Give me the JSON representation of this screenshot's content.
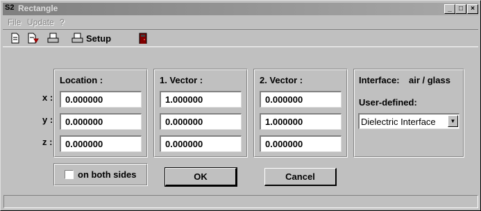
{
  "window": {
    "title": "Rectangle",
    "icon_text": "S2"
  },
  "titlebar_buttons": {
    "minimize": "_",
    "maximize": "□",
    "close": "×"
  },
  "menu": [
    {
      "label": "File"
    },
    {
      "label": "Update"
    },
    {
      "label": "?"
    }
  ],
  "toolbar": {
    "setup_label": "Setup",
    "icons": [
      "new-document-icon",
      "save-document-icon",
      "print-icon",
      "printer-icon",
      "exit-door-icon"
    ]
  },
  "axes": {
    "x": "x :",
    "y": "y :",
    "z": "z :"
  },
  "location": {
    "title": "Location :",
    "x": "0.000000",
    "y": "0.000000",
    "z": "0.000000"
  },
  "vector1": {
    "title": "1. Vector :",
    "x": "1.000000",
    "y": "0.000000",
    "z": "0.000000"
  },
  "vector2": {
    "title": "2. Vector :",
    "x": "0.000000",
    "y": "1.000000",
    "z": "0.000000"
  },
  "interface": {
    "label": "Interface:",
    "value": "air / glass",
    "user_defined_label": "User-defined:",
    "selected": "Dielectric Interface"
  },
  "both_sides": {
    "label": "on both sides",
    "checked": false
  },
  "buttons": {
    "ok": "OK",
    "cancel": "Cancel"
  },
  "status": {
    "text": ""
  }
}
